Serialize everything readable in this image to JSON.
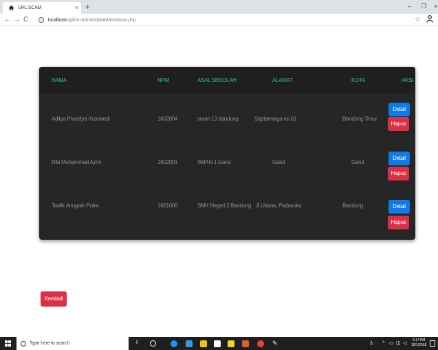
{
  "browser": {
    "tab_title": "URL SCAM",
    "tab_close": "×",
    "new_tab": "+",
    "minimize": "–",
    "maximize": "❐",
    "url_host": "localhost",
    "url_path": "/opil/on-admin/dataMahasiswa.php"
  },
  "table": {
    "headers": [
      "NAMA",
      "NPM",
      "ASAL SEKOLAH",
      "ALAMAT",
      "KOTA",
      "AKSI"
    ],
    "rows": [
      {
        "nama": "Aditya Prasetya Kusnaedi",
        "npm": "1602004",
        "asal": "sman 13 bandung",
        "alamat": "Saptamarga no 61",
        "kota": "Bandung Timur"
      },
      {
        "nama": "Riki Muhammad Azmi",
        "npm": "1602001",
        "asal": "SMAN 1 Garut",
        "alamat": "Garut",
        "kota": "Garut"
      },
      {
        "nama": "Taofik Anugrah Putra",
        "npm": "1601006",
        "asal": "SMK Negeri 2 Bandung",
        "alamat": "Jl.Utama, Padasuka",
        "kota": "Bandung"
      }
    ],
    "detail_label": "Detail",
    "hapus_label": "Hapus"
  },
  "kembali_label": "Kembali",
  "taskbar": {
    "search_placeholder": "Type here to search",
    "time": "3:17 PM",
    "date": "10/1/2018"
  },
  "colors": {
    "header_text": "#28c76f",
    "detail_button": "#0d7be8",
    "hapus_button": "#dc2f45",
    "table_bg": "#262626"
  }
}
